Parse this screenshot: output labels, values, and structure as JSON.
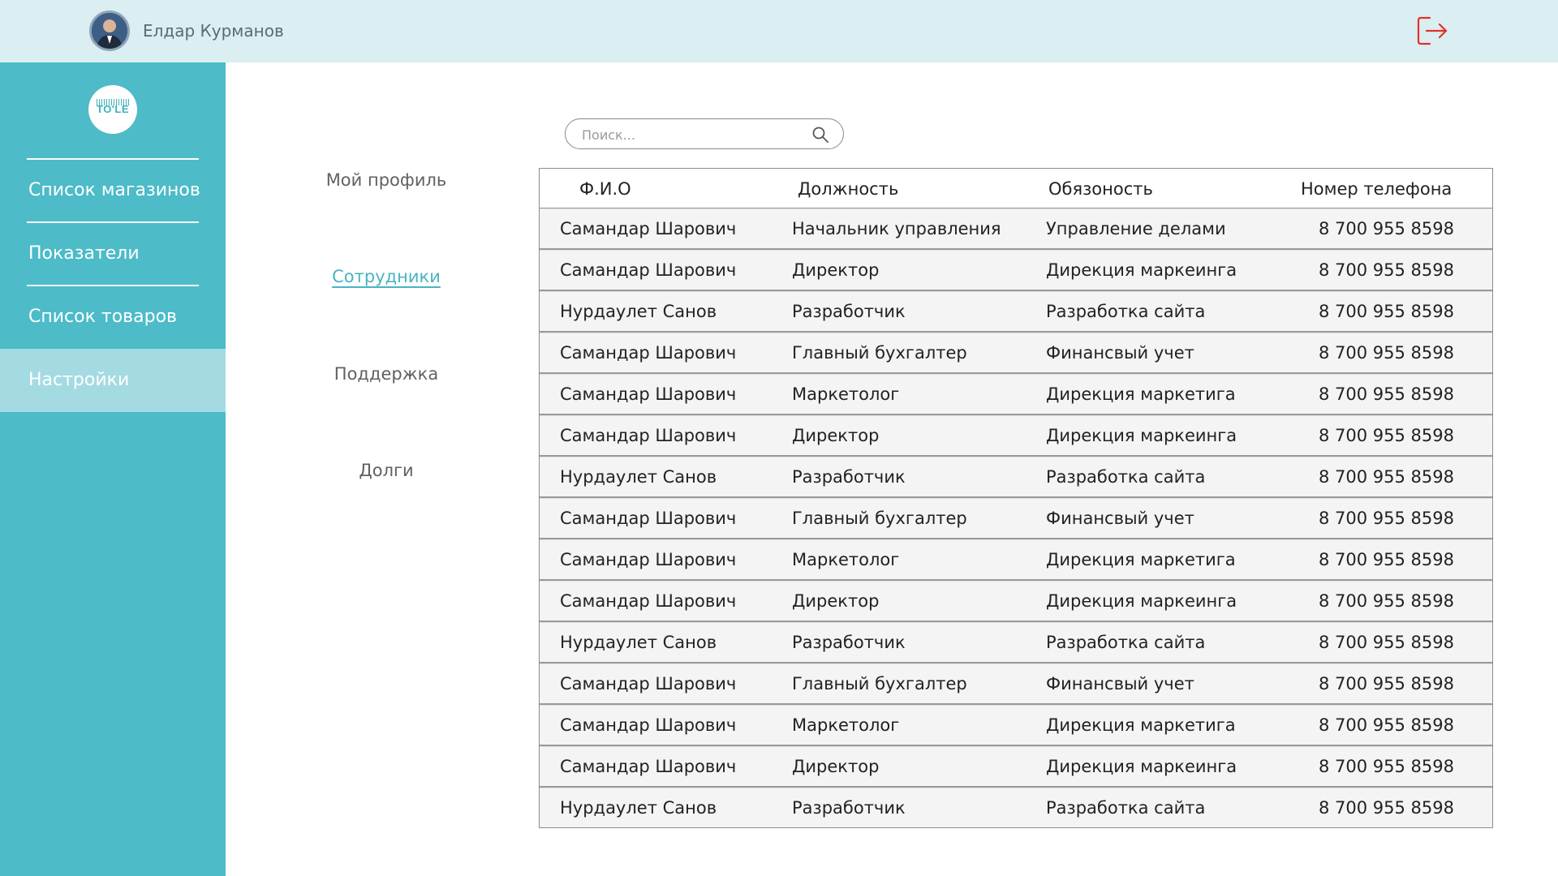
{
  "header": {
    "user_name": "Елдар Курманов",
    "avatar_icon": "user-avatar",
    "logout_icon": "logout-icon",
    "logout_color": "#e2302a"
  },
  "sidebar": {
    "logo_text": "TO'LE",
    "items": [
      {
        "label": "Список магазинов",
        "active": false
      },
      {
        "label": "Показатели",
        "active": false
      },
      {
        "label": "Список товаров",
        "active": false
      },
      {
        "label": "Настройки",
        "active": true
      }
    ],
    "bg_color": "#4dbbc8",
    "active_color": "#a4dbe2"
  },
  "submenu": {
    "items": [
      {
        "label": "Мой профиль",
        "active": false
      },
      {
        "label": "Сотрудники",
        "active": true
      },
      {
        "label": "Поддержка",
        "active": false
      },
      {
        "label": "Долги",
        "active": false
      }
    ]
  },
  "search": {
    "placeholder": "Поиск...",
    "value": "",
    "icon": "search-icon"
  },
  "table": {
    "columns": [
      "Ф.И.О",
      "Должность",
      "Обязоность",
      "Номер телефона"
    ],
    "rows": [
      [
        "Самандар Шарович",
        "Начальник управления",
        "Управление делами",
        "8 700 955 8598"
      ],
      [
        "Самандар Шарович",
        "Директор",
        "Дирекция маркеинга",
        "8 700 955 8598"
      ],
      [
        "Нурдаулет Санов",
        "Разработчик",
        "Разработка сайта",
        "8 700 955 8598"
      ],
      [
        "Самандар Шарович",
        "Главный бухгалтер",
        "Финансвый учет",
        "8 700 955 8598"
      ],
      [
        "Самандар Шарович",
        "Маркетолог",
        "Дирекция маркетига",
        "8 700 955 8598"
      ],
      [
        "Самандар Шарович",
        "Директор",
        "Дирекция маркеинга",
        "8 700 955 8598"
      ],
      [
        "Нурдаулет Санов",
        "Разработчик",
        "Разработка сайта",
        "8 700 955 8598"
      ],
      [
        "Самандар Шарович",
        "Главный бухгалтер",
        "Финансвый учет",
        "8 700 955 8598"
      ],
      [
        "Самандар Шарович",
        "Маркетолог",
        "Дирекция маркетига",
        "8 700 955 8598"
      ],
      [
        "Самандар Шарович",
        "Директор",
        "Дирекция маркеинга",
        "8 700 955 8598"
      ],
      [
        "Нурдаулет Санов",
        "Разработчик",
        "Разработка сайта",
        "8 700 955 8598"
      ],
      [
        "Самандар Шарович",
        "Главный бухгалтер",
        "Финансвый учет",
        "8 700 955 8598"
      ],
      [
        "Самандар Шарович",
        "Маркетолог",
        "Дирекция маркетига",
        "8 700 955 8598"
      ],
      [
        "Самандар Шарович",
        "Директор",
        "Дирекция маркеинга",
        "8 700 955 8598"
      ],
      [
        "Нурдаулет Санов",
        "Разработчик",
        "Разработка сайта",
        "8 700 955 8598"
      ]
    ]
  }
}
